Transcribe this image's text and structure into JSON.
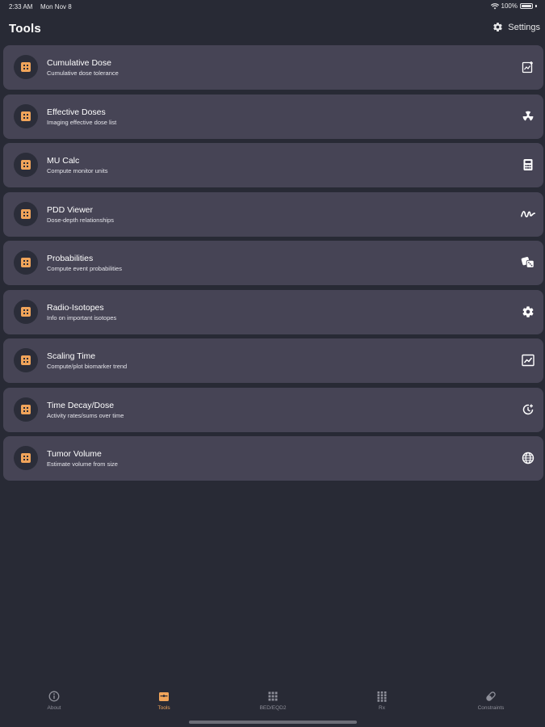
{
  "status_bar": {
    "time": "2:33 AM",
    "date": "Mon Nov 8",
    "battery": "100%"
  },
  "header": {
    "title": "Tools",
    "settings_label": "Settings"
  },
  "colors": {
    "background": "#282a35",
    "card": "#464455",
    "accent": "#f0a45a"
  },
  "tools": [
    {
      "title": "Cumulative Dose",
      "subtitle": "Cumulative dose tolerance",
      "icon": "chart-doc-icon"
    },
    {
      "title": "Effective Doses",
      "subtitle": "Imaging effective dose list",
      "icon": "radiation-icon"
    },
    {
      "title": "MU Calc",
      "subtitle": "Compute monitor units",
      "icon": "calculator-icon"
    },
    {
      "title": "PDD Viewer",
      "subtitle": "Dose-depth relationships",
      "icon": "wave-icon"
    },
    {
      "title": "Probabilities",
      "subtitle": "Compute event probabilities",
      "icon": "dice-icon"
    },
    {
      "title": "Radio-Isotopes",
      "subtitle": "Info on important isotopes",
      "icon": "isotope-icon"
    },
    {
      "title": "Scaling Time",
      "subtitle": "Compute/plot biomarker trend",
      "icon": "trend-chart-icon"
    },
    {
      "title": "Time Decay/Dose",
      "subtitle": "Activity rates/sums over time",
      "icon": "clock-decay-icon"
    },
    {
      "title": "Tumor Volume",
      "subtitle": "Estimate volume from size",
      "icon": "globe-icon"
    }
  ],
  "tabbar": {
    "items": [
      {
        "label": "About",
        "icon": "info-icon"
      },
      {
        "label": "Tools",
        "icon": "toolbox-icon",
        "active": true
      },
      {
        "label": "BED/EQD2",
        "icon": "grid-icon"
      },
      {
        "label": "Rx",
        "icon": "grid-dots-icon"
      },
      {
        "label": "Constraints",
        "icon": "pill-icon"
      }
    ]
  }
}
